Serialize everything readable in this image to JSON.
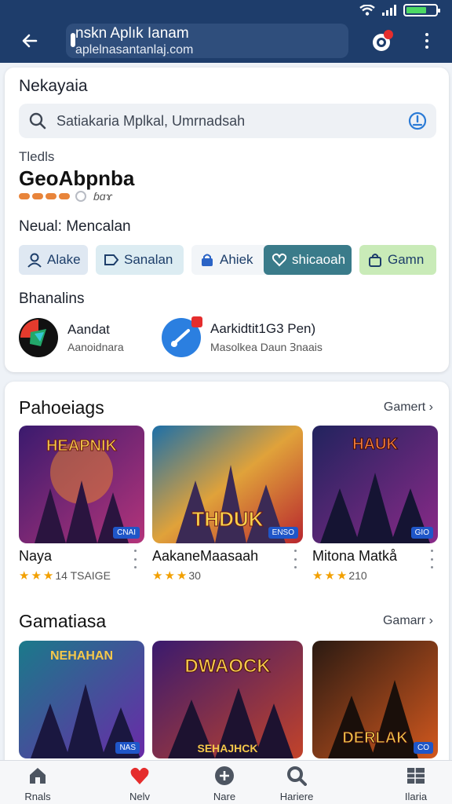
{
  "header": {
    "url_title": "nskn Aplık Ianam",
    "url_subtitle": "aplelnasantanlaj.com"
  },
  "search_card": {
    "title": "Nekayaia",
    "search_placeholder": "Satiakaria Mplkal, Umrnadsah",
    "small_label": "Tledls",
    "app_name": "GeoAbpnba",
    "rating_text": "ɓɑɤ",
    "section_mencalan": "Neual: Mencalan",
    "chips": [
      {
        "label": "Alake",
        "icon": "person-icon"
      },
      {
        "label": "Sanalan",
        "icon": "tag-icon"
      },
      {
        "label": "Ahiek",
        "icon": "lock-icon"
      },
      {
        "label": "shicaoah",
        "icon": "heart-icon"
      },
      {
        "label": "Gamn",
        "icon": "bag-icon"
      }
    ],
    "section_apps": "Bhanalins",
    "apps": [
      {
        "title": "Aandat",
        "subtitle": "Aanoidnara"
      },
      {
        "title": "Aarkidtit1G3 Pen)",
        "subtitle": "Masolkea Daun Ɜnaais"
      }
    ]
  },
  "section1": {
    "heading": "Pahoeiags",
    "more": "Gamert",
    "tiles": [
      {
        "art_text": "HEAPNIK",
        "badge": "CNAI",
        "title": "Naya",
        "rating": "14 TSAIGE"
      },
      {
        "art_text": "THDUK",
        "badge": "ENSO",
        "title": "AakaneMaasaah",
        "rating": "30"
      },
      {
        "art_text": "HAUK",
        "badge": "GIO",
        "title": "Mitona Matkå",
        "rating": "210"
      }
    ]
  },
  "section2": {
    "heading": "Gamatiasa",
    "more": "Gamarr",
    "tiles": [
      {
        "art_text": "NEHAHAN",
        "badge": "NAS"
      },
      {
        "art_text": "DWAOCK",
        "badge": "SEHAJHCK"
      },
      {
        "art_text": "DERLAK",
        "badge": "CO"
      }
    ]
  },
  "bottom_nav": [
    {
      "label": "Rnals",
      "icon": "home-icon"
    },
    {
      "label": "Nelv",
      "icon": "heart-icon"
    },
    {
      "label": "Nare",
      "icon": "add-circle-icon"
    },
    {
      "label": "Hariere",
      "icon": "search-icon"
    },
    {
      "label": "Ilaria",
      "icon": "grid-icon"
    }
  ],
  "colors": {
    "topbar": "#1e3d6b",
    "accent_teal": "#3a7b8a",
    "accent_green": "#c9ebb8",
    "star": "#f2a000"
  }
}
